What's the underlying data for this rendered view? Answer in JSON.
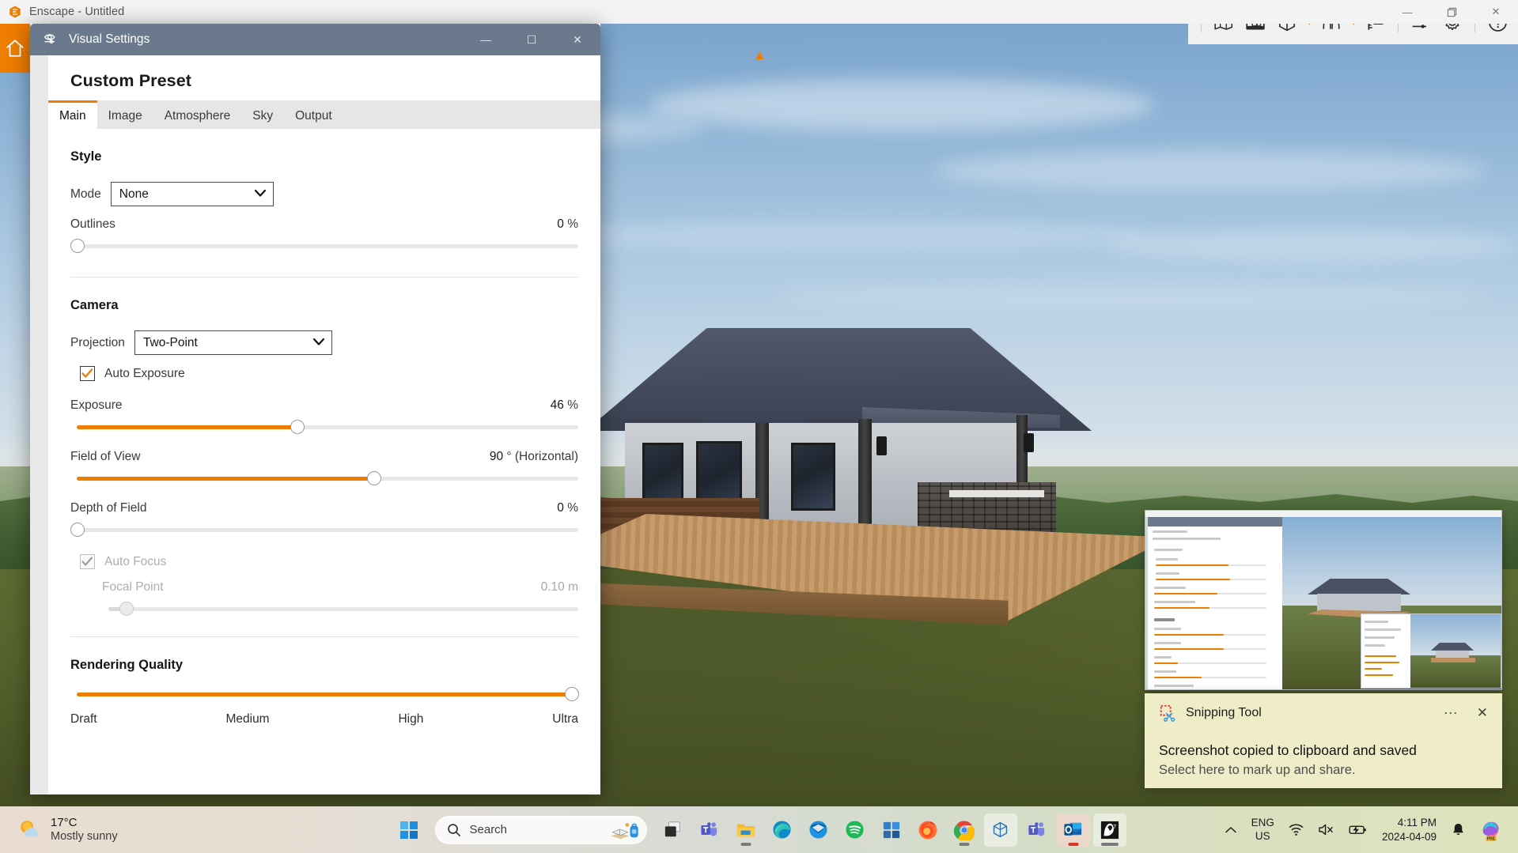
{
  "app": {
    "title": "Enscape - Untitled",
    "logo_icon": "enscape-logo-icon",
    "window_controls": {
      "minimize": "—",
      "restore": "❐",
      "close": "✕"
    },
    "toolbar": [
      {
        "name": "site-context-button",
        "icon": "map-pin-icon"
      },
      {
        "name": "asset-library-button",
        "icon": "building-image-icon"
      },
      {
        "name": "rendering-mode-button",
        "icon": "hexagon-split-icon"
      },
      {
        "name": "rendering-mode-dropdown",
        "icon": "chevron-down-icon"
      },
      {
        "name": "panorama-button",
        "icon": "double-arch-icon"
      },
      {
        "name": "panorama-dropdown",
        "icon": "chevron-down-icon"
      },
      {
        "name": "vr-mode-button",
        "icon": "vr-headset-icon"
      },
      {
        "name": "visual-settings-button",
        "icon": "eye-slider-icon"
      },
      {
        "name": "settings-button",
        "icon": "gear-icon"
      },
      {
        "name": "help-button",
        "icon": "question-circle-icon"
      }
    ],
    "collapse_arrow_icon": "chevron-left-icon",
    "top_caret_icon": "chevron-up-icon"
  },
  "visual_settings": {
    "title": "Visual Settings",
    "title_icon": "eye-settings-icon",
    "window_controls": {
      "minimize": "—",
      "maximize": "☐",
      "close": "✕"
    },
    "preset_name": "Custom Preset",
    "tabs": [
      {
        "label": "Main",
        "active": true
      },
      {
        "label": "Image",
        "active": false
      },
      {
        "label": "Atmosphere",
        "active": false
      },
      {
        "label": "Sky",
        "active": false
      },
      {
        "label": "Output",
        "active": false
      }
    ],
    "style": {
      "section_title": "Style",
      "mode_label": "Mode",
      "mode_value": "None",
      "mode_options": [
        "None"
      ],
      "outlines_label": "Outlines",
      "outlines_value": "0",
      "outlines_unit": "%",
      "outlines_percent": 0
    },
    "camera": {
      "section_title": "Camera",
      "projection_label": "Projection",
      "projection_value": "Two-Point",
      "projection_options": [
        "Two-Point"
      ],
      "auto_exposure_label": "Auto Exposure",
      "auto_exposure_checked": true,
      "exposure_label": "Exposure",
      "exposure_value": "46",
      "exposure_unit": "%",
      "exposure_percent": 46,
      "fov_label": "Field of View",
      "fov_value": "90",
      "fov_unit": "° (Horizontal)",
      "fov_percent": 61,
      "dof_label": "Depth of Field",
      "dof_value": "0",
      "dof_unit": "%",
      "dof_percent": 0,
      "auto_focus_label": "Auto Focus",
      "auto_focus_checked": true,
      "auto_focus_enabled": false,
      "focal_point_label": "Focal Point",
      "focal_point_value": "0.10",
      "focal_point_unit": "m",
      "focal_point_percent": 6
    },
    "rendering_quality": {
      "section_title": "Rendering Quality",
      "value_percent": 100,
      "ticks": [
        "Draft",
        "Medium",
        "High",
        "Ultra"
      ]
    }
  },
  "toast": {
    "app_name": "Snipping Tool",
    "app_icon": "snipping-tool-icon",
    "more_icon": "ellipsis-icon",
    "close_icon": "close-icon",
    "line1": "Screenshot copied to clipboard and saved",
    "line2": "Select here to mark up and share."
  },
  "taskbar": {
    "weather": {
      "temperature": "17°C",
      "condition": "Mostly sunny",
      "icon": "sun-cloud-icon"
    },
    "start": {
      "name": "start-button",
      "icon": "windows-logo-icon"
    },
    "search": {
      "placeholder": "Search",
      "icon": "search-icon",
      "illustration_icon": "notebook-backpack-icon"
    },
    "apps": [
      {
        "name": "task-view-button",
        "icon": "task-view-icon",
        "running": false
      },
      {
        "name": "teams-button",
        "icon": "teams-icon",
        "running": false
      },
      {
        "name": "file-explorer-button",
        "icon": "folder-icon",
        "running": true
      },
      {
        "name": "edge-button",
        "icon": "edge-icon",
        "running": false
      },
      {
        "name": "thunderbird-button",
        "icon": "thunderbird-icon",
        "running": false
      },
      {
        "name": "spotify-button",
        "icon": "spotify-icon",
        "running": false
      },
      {
        "name": "store-button",
        "icon": "microsoft-store-icon",
        "running": false
      },
      {
        "name": "firefox-button",
        "icon": "firefox-icon",
        "running": false
      },
      {
        "name": "chrome-button",
        "icon": "chrome-icon",
        "running": true
      },
      {
        "name": "sketchup-button",
        "icon": "sketchup-icon",
        "running": false
      },
      {
        "name": "teams-work-button",
        "icon": "teams-icon",
        "running": false
      },
      {
        "name": "outlook-button",
        "icon": "outlook-icon",
        "running": true
      },
      {
        "name": "enscape-button",
        "icon": "enscape-app-icon",
        "running": true
      }
    ],
    "tray": {
      "overflow_icon": "chevron-up-icon",
      "language_line1": "ENG",
      "language_line2": "US",
      "wifi_icon": "wifi-icon",
      "volume_icon": "speaker-muted-icon",
      "battery_icon": "battery-charging-icon",
      "time": "4:11 PM",
      "date": "2024-04-09",
      "notification_icon": "bell-icon",
      "copilot_icon": "copilot-icon",
      "copilot_badge": "PRE"
    }
  },
  "colors": {
    "accent_orange": "#ef7d00",
    "dialog_titlebar": "#6a7a8c",
    "toast_background": "#efecc8"
  }
}
